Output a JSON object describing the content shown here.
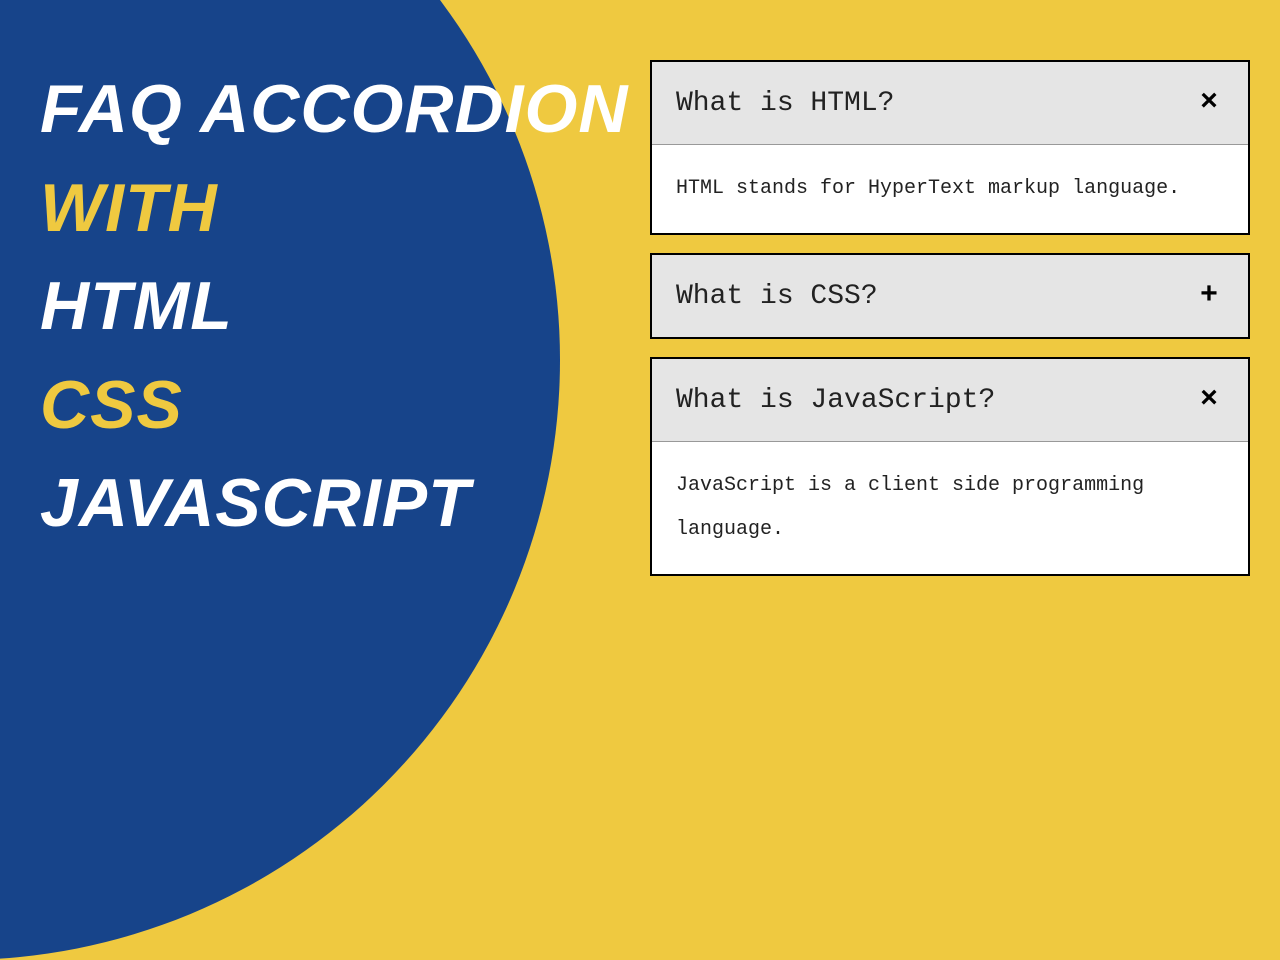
{
  "hero": {
    "line1": "FAQ ACCORDION",
    "line2": "WITH",
    "line3": "HTML",
    "line4": "CSS",
    "line5": "JAVASCRIPT"
  },
  "faq": [
    {
      "question": "What is HTML?",
      "answer": "HTML stands for HyperText markup language.",
      "expanded": true,
      "toggle": "×"
    },
    {
      "question": "What is CSS?",
      "answer": "",
      "expanded": false,
      "toggle": "+"
    },
    {
      "question": "What is JavaScript?",
      "answer": "JavaScript is a client side programming language.",
      "expanded": true,
      "toggle": "×"
    }
  ]
}
